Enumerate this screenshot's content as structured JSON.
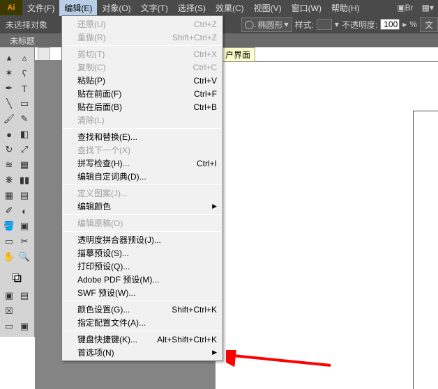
{
  "logo": "Ai",
  "menubar": {
    "file": "文件(F)",
    "edit": "编辑(E)",
    "object": "对象(O)",
    "type": "文字(T)",
    "select": "选择(S)",
    "effect": "效果(C)",
    "view": "视图(V)",
    "window": "窗口(W)",
    "help": "帮助(H)"
  },
  "toolbar": {
    "no_selection": "未选择对象",
    "shape": "椭圆形",
    "style_label": "样式:",
    "opacity_label": "不透明度:",
    "opacity_value": "100",
    "percent": "%",
    "doc_btn": "文"
  },
  "doc_tab": "未标题",
  "workspace_label": "户界面",
  "edit_menu": {
    "undo": {
      "label": "还原(U)",
      "hotkey": "Ctrl+Z",
      "disabled": true
    },
    "redo": {
      "label": "重做(R)",
      "hotkey": "Shift+Ctrl+Z",
      "disabled": true
    },
    "cut": {
      "label": "剪切(T)",
      "hotkey": "Ctrl+X",
      "disabled": true
    },
    "copy": {
      "label": "复制(C)",
      "hotkey": "Ctrl+C",
      "disabled": true
    },
    "paste": {
      "label": "粘贴(P)",
      "hotkey": "Ctrl+V",
      "disabled": false
    },
    "paste_front": {
      "label": "贴在前面(F)",
      "hotkey": "Ctrl+F",
      "disabled": false
    },
    "paste_back": {
      "label": "贴在后面(B)",
      "hotkey": "Ctrl+B",
      "disabled": false
    },
    "clear": {
      "label": "清除(L)",
      "hotkey": "",
      "disabled": true
    },
    "find_replace": {
      "label": "查找和替换(E)...",
      "hotkey": "",
      "disabled": false
    },
    "find_next": {
      "label": "查找下一个(X)",
      "hotkey": "",
      "disabled": true
    },
    "spell": {
      "label": "拼写检查(H)...",
      "hotkey": "Ctrl+I",
      "disabled": false
    },
    "custom_dict": {
      "label": "编辑自定词典(D)...",
      "hotkey": "",
      "disabled": false
    },
    "define_pat": {
      "label": "定义图案(J)...",
      "hotkey": "",
      "disabled": true
    },
    "edit_colors": {
      "label": "编辑颜色",
      "hotkey": "",
      "disabled": false,
      "submenu": true
    },
    "edit_orig": {
      "label": "编辑原稿(O)",
      "hotkey": "",
      "disabled": true
    },
    "flattener": {
      "label": "透明度拼合器预设(J)...",
      "hotkey": "",
      "disabled": false
    },
    "tracing": {
      "label": "描摹预设(S)...",
      "hotkey": "",
      "disabled": false
    },
    "print": {
      "label": "打印预设(Q)...",
      "hotkey": "",
      "disabled": false
    },
    "pdf": {
      "label": "Adobe PDF 预设(M)...",
      "hotkey": "",
      "disabled": false
    },
    "swf": {
      "label": "SWF 预设(W)...",
      "hotkey": "",
      "disabled": false
    },
    "color_set": {
      "label": "颜色设置(G)...",
      "hotkey": "Shift+Ctrl+K",
      "disabled": false
    },
    "profiles": {
      "label": "指定配置文件(A)...",
      "hotkey": "",
      "disabled": false
    },
    "shortcuts": {
      "label": "键盘快捷键(K)...",
      "hotkey": "Alt+Shift+Ctrl+K",
      "disabled": false
    },
    "prefs": {
      "label": "首选项(N)",
      "hotkey": "",
      "disabled": false,
      "submenu": true
    }
  }
}
